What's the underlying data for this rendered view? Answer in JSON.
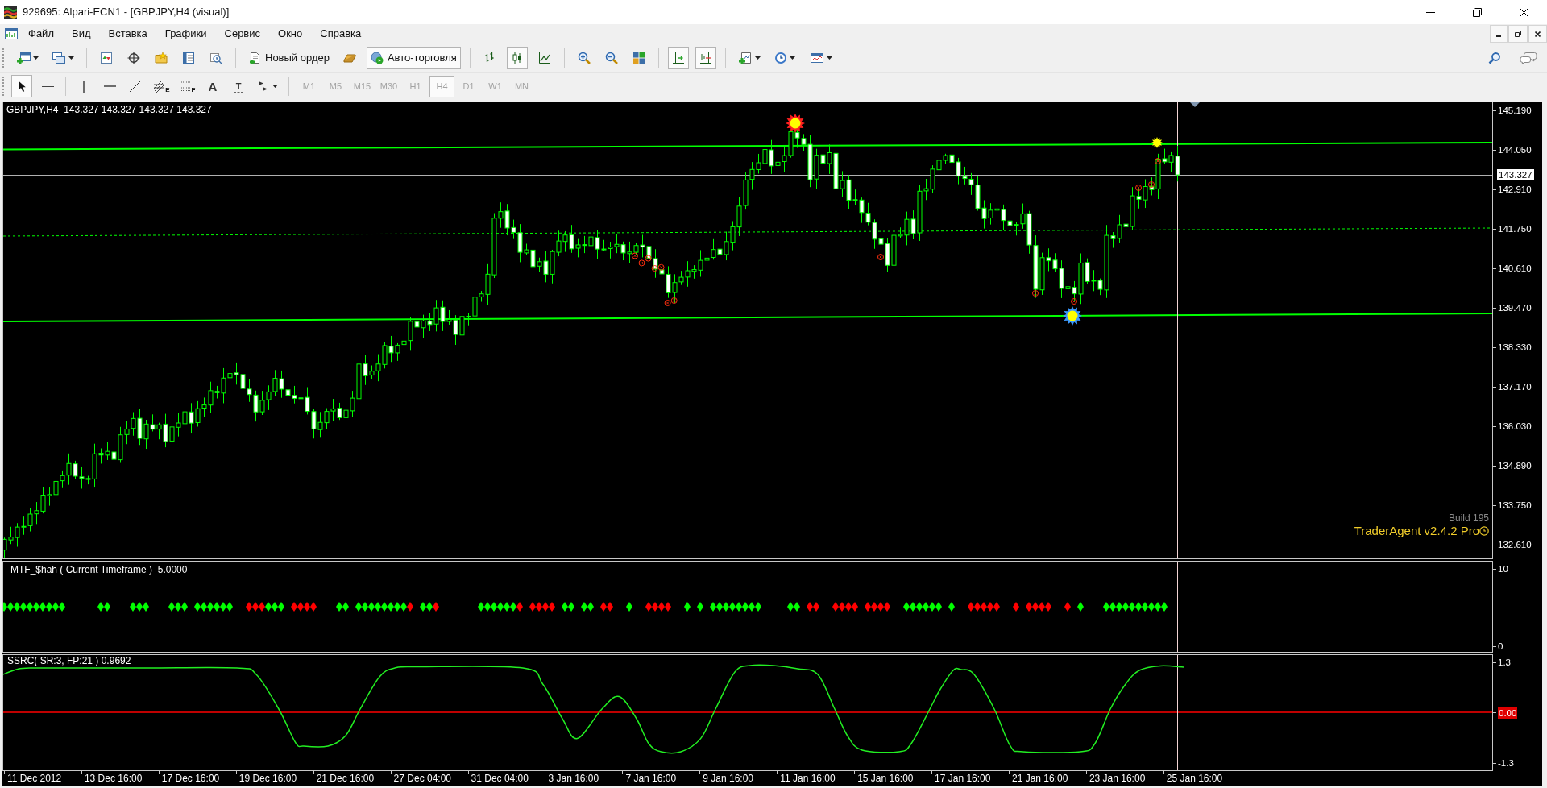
{
  "window": {
    "title": "929695: Alpari-ECN1 - [GBPJPY,H4 (visual)]"
  },
  "menu": [
    "Файл",
    "Вид",
    "Вставка",
    "Графики",
    "Сервис",
    "Окно",
    "Справка"
  ],
  "toolbar": {
    "new_order": "Новый ордер",
    "auto_trading": {
      "label": "Авто-торговля",
      "on": true
    },
    "chart_types": [
      {
        "kind": "bars",
        "selected": false
      },
      {
        "kind": "candles",
        "selected": true
      },
      {
        "kind": "line",
        "selected": false
      }
    ],
    "chart_shift": {
      "on": true
    },
    "autoscroll": {
      "on": true
    }
  },
  "drawing_tools": [
    {
      "kind": "cursor",
      "selected": true
    },
    {
      "kind": "crosshair",
      "selected": false
    },
    {
      "kind": "vertical_line",
      "selected": false
    },
    {
      "kind": "horizontal_line",
      "selected": false
    },
    {
      "kind": "trend_line",
      "selected": false
    },
    {
      "kind": "channel",
      "label": "E",
      "selected": false
    },
    {
      "kind": "fibonacci",
      "label": "F",
      "selected": false
    },
    {
      "kind": "text",
      "label": "A",
      "selected": false
    },
    {
      "kind": "text_label",
      "label": "T",
      "selected": false
    },
    {
      "kind": "arrows",
      "selected": false
    }
  ],
  "periods": [
    {
      "label": "M1",
      "selected": false,
      "disabled": true
    },
    {
      "label": "M5",
      "selected": false,
      "disabled": true
    },
    {
      "label": "M15",
      "selected": false,
      "disabled": true
    },
    {
      "label": "M30",
      "selected": false,
      "disabled": true
    },
    {
      "label": "H1",
      "selected": false,
      "disabled": true
    },
    {
      "label": "H4",
      "selected": true,
      "disabled": true
    },
    {
      "label": "D1",
      "selected": false,
      "disabled": true
    },
    {
      "label": "W1",
      "selected": false,
      "disabled": true
    },
    {
      "label": "MN",
      "selected": false,
      "disabled": true
    }
  ],
  "chart": {
    "title": "GBPJPY,H4  143.327 143.327 143.327 143.327",
    "price_axis": [
      "145.190",
      "144.050",
      "142.910",
      "141.750",
      "140.610",
      "139.470",
      "138.330",
      "137.170",
      "136.030",
      "134.890",
      "133.750",
      "132.610"
    ],
    "current_price": "143.327",
    "build": "Build 195",
    "expert": "TraderAgent v2.4.2 Pro"
  },
  "indicators": [
    {
      "kind": "signals",
      "title": "MTF_$hah ( Current Timeframe )  5.0000",
      "axis": [
        {
          "label": "10",
          "highlighted": false
        },
        {
          "label": "0",
          "highlighted": false
        }
      ]
    },
    {
      "kind": "oscillator",
      "title": "SSRC( SR:3, FP:21 ) 0.9692",
      "axis": [
        {
          "label": "1.3",
          "highlighted": false
        },
        {
          "label": "0.00",
          "highlighted": true
        },
        {
          "label": "-1.3",
          "highlighted": false
        }
      ]
    }
  ],
  "time_axis": [
    "11 Dec 2012",
    "13 Dec 16:00",
    "17 Dec 16:00",
    "19 Dec 16:00",
    "21 Dec 16:00",
    "27 Dec 04:00",
    "31 Dec 04:00",
    "3 Jan 16:00",
    "7 Jan 16:00",
    "9 Jan 16:00",
    "11 Jan 16:00",
    "15 Jan 16:00",
    "17 Jan 16:00",
    "21 Jan 16:00",
    "23 Jan 16:00",
    "25 Jan 16:00"
  ]
}
